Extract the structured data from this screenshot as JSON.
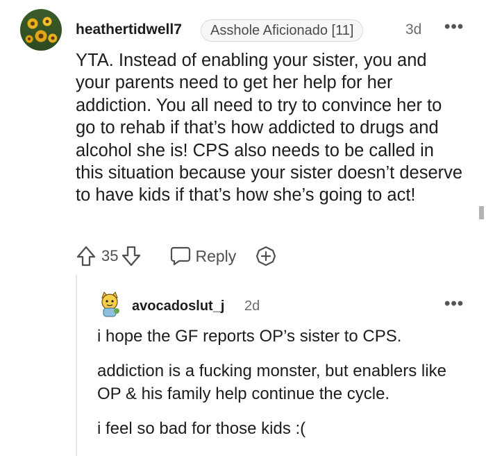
{
  "comment": {
    "username": "heathertidwell7",
    "flair": "Asshole Aficionado [11]",
    "timestamp": "3d",
    "more_icon": "ellipsis-icon",
    "avatar_icon": "sunflower-avatar",
    "text": "YTA. Instead of enabling your sister, you and your parents need to get her help for her addiction. You all need to try to convince her to go to rehab if that’s how addicted to drugs and alcohol she is! CPS also needs to be called in this situation because your sister doesn’t deserve to have kids if that’s how she’s going to act!",
    "votes": "35",
    "reply_label": "Reply"
  },
  "reply": {
    "username": "avocadoslut_j",
    "timestamp": "2d",
    "avatar_icon": "cartoon-avatar",
    "paragraphs": [
      "i hope the GF reports OP’s sister to CPS.",
      "addiction is a fucking monster, but enablers like OP & his family help continue the cycle.",
      "i feel so bad for those kids :("
    ]
  },
  "colors": {
    "text": "#1c1c1c",
    "meta": "#6b6b6b",
    "icon": "#4f4f4f",
    "flair_bg": "#f6f7f8"
  }
}
